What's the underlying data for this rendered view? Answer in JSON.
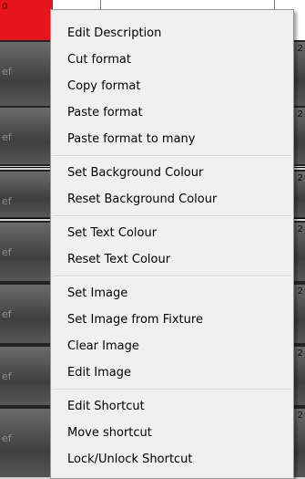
{
  "top_tab_marker": "0",
  "row_numbers": [
    "2",
    "2",
    "2",
    "2",
    "2",
    "2",
    "2"
  ],
  "row_fragments": [
    "ef",
    "ef",
    "ef",
    "ef",
    "ef",
    "ef",
    "ef"
  ],
  "menu": {
    "groups": [
      [
        "Edit Description",
        "Cut format",
        "Copy format",
        "Paste format",
        "Paste format to many"
      ],
      [
        "Set Background Colour",
        "Reset Background Colour"
      ],
      [
        "Set Text Colour",
        "Reset Text Colour"
      ],
      [
        "Set Image",
        "Set Image from Fixture",
        "Clear Image",
        "Edit Image"
      ],
      [
        "Edit Shortcut",
        "Move shortcut",
        "Lock/Unlock Shortcut"
      ]
    ]
  }
}
